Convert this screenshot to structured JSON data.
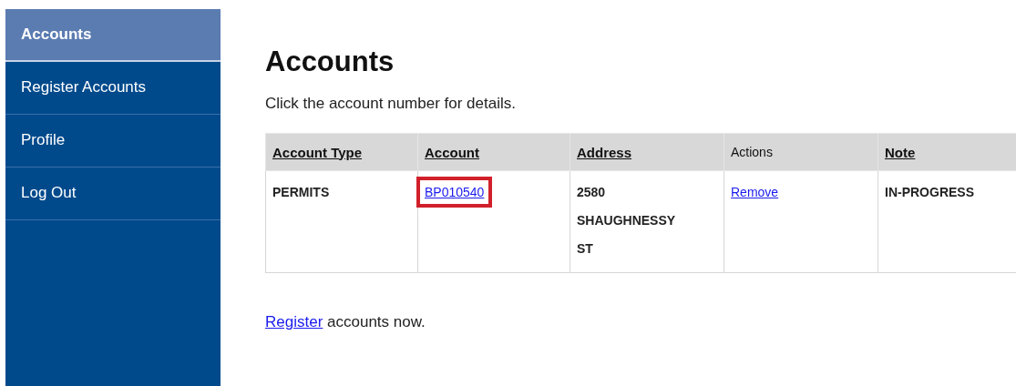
{
  "sidebar": {
    "items": [
      {
        "label": "Accounts",
        "selected": true
      },
      {
        "label": "Register Accounts",
        "selected": false
      },
      {
        "label": "Profile",
        "selected": false
      },
      {
        "label": "Log Out",
        "selected": false
      }
    ]
  },
  "page": {
    "title": "Accounts",
    "intro": "Click the account number for details."
  },
  "table": {
    "columns": [
      {
        "label": "Account Type",
        "sortable": true
      },
      {
        "label": "Account",
        "sortable": true
      },
      {
        "label": "Address",
        "sortable": true
      },
      {
        "label": "Actions",
        "sortable": false
      },
      {
        "label": "Note",
        "sortable": true
      }
    ],
    "rows": [
      {
        "account_type": "PERMITS",
        "account": "BP010540",
        "account_highlighted": true,
        "address": [
          "2580",
          "SHAUGHNESSY",
          "ST"
        ],
        "action": "Remove",
        "note": "IN-PROGRESS"
      }
    ]
  },
  "footer": {
    "link": "Register",
    "text": "accounts now."
  }
}
